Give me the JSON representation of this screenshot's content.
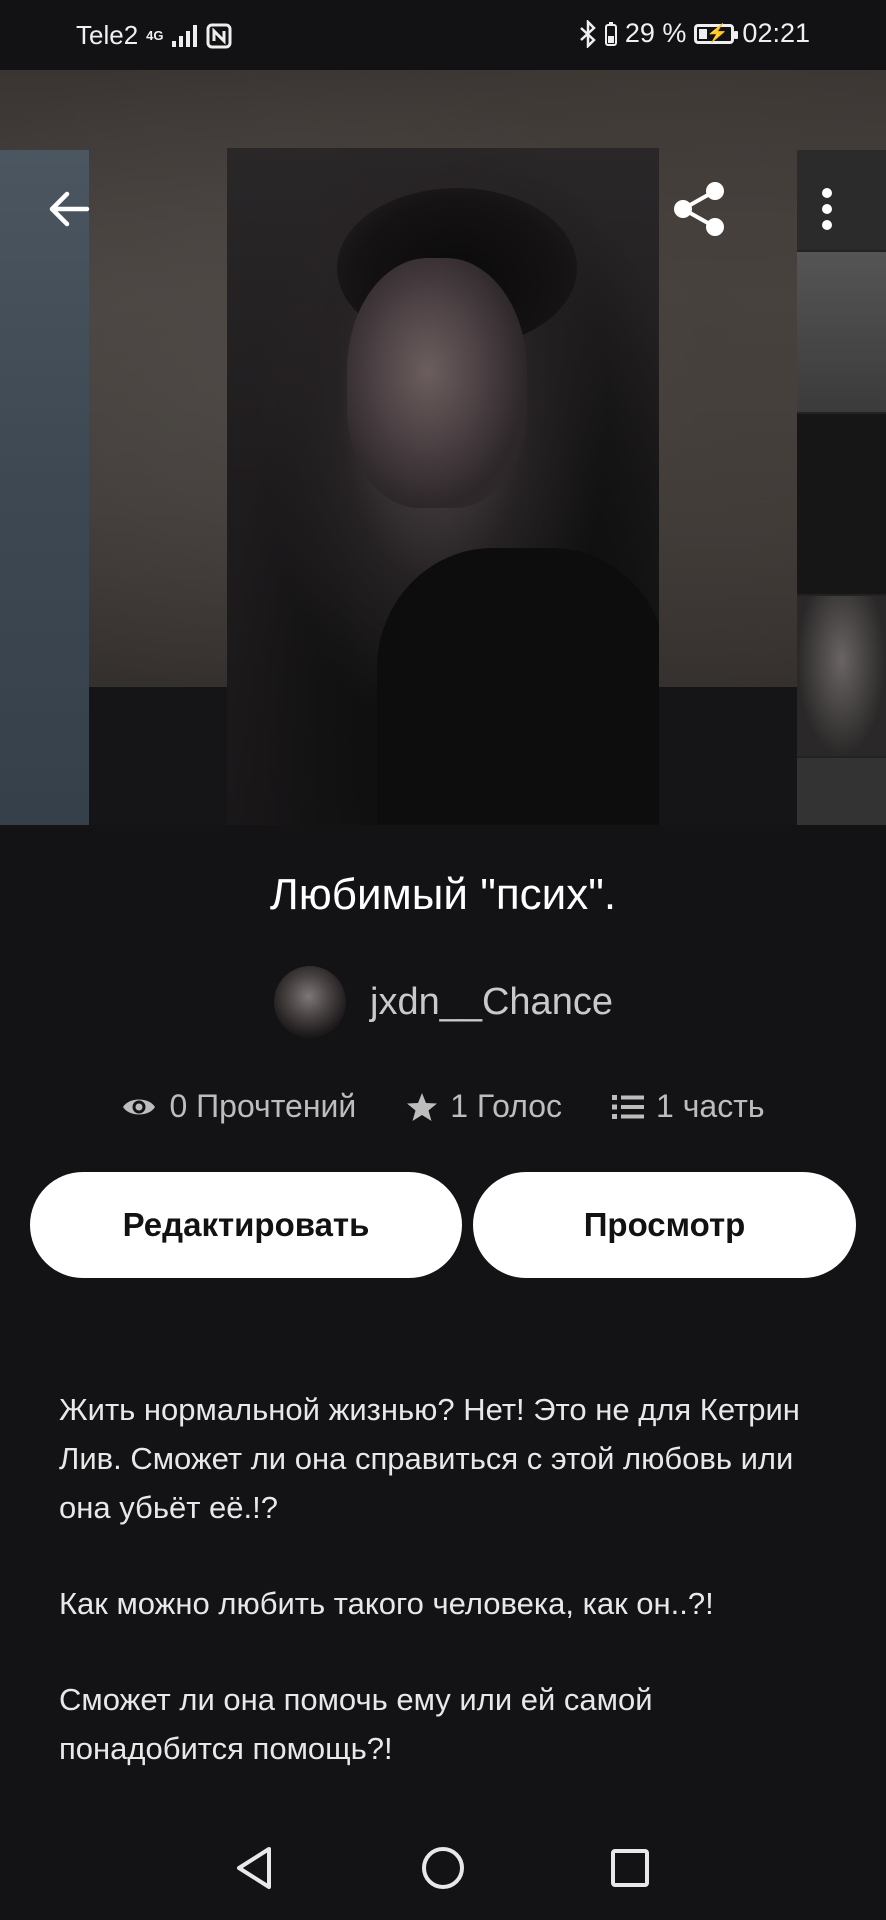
{
  "status_bar": {
    "carrier": "Tele2",
    "network": "4G",
    "battery": "29 %",
    "time": "02:21"
  },
  "header": {
    "back_icon": "arrow-left-icon",
    "share_icon": "share-icon",
    "menu_icon": "more-vertical-icon"
  },
  "story": {
    "title": "Любимый \"псих\".",
    "author": "jxdn__Chance",
    "stats": {
      "reads": "0 Прочтений",
      "votes": "1 Голос",
      "parts": "1 часть"
    },
    "buttons": {
      "edit": "Редактировать",
      "preview": "Просмотр"
    },
    "description": [
      "Жить нормальной жизнью? Нет! Это не для Кетрин Лив. Сможет ли она справиться с этой любовь или она убьёт её.!?",
      "Как можно любить такого человека, как он..?!",
      "Сможет ли она помочь ему или ей самой понадобится помощь?!"
    ]
  },
  "colors": {
    "background": "#131215",
    "button_bg": "#ffffff",
    "button_text": "#121212",
    "muted_text": "#bdbdbd"
  }
}
